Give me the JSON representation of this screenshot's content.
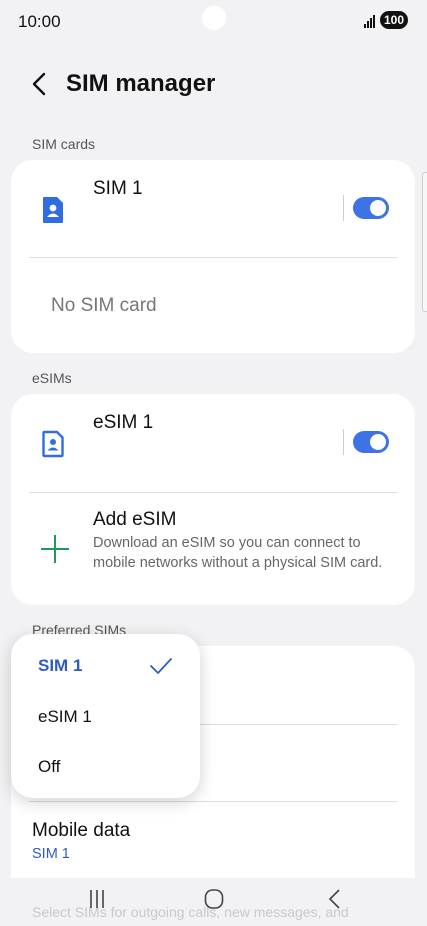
{
  "status_bar": {
    "time": "10:00",
    "battery": "100"
  },
  "header": {
    "title": "SIM manager"
  },
  "sim_cards": {
    "section_label": "SIM cards",
    "sim1": {
      "name": "SIM 1",
      "enabled": true
    },
    "empty_slot": "No SIM card"
  },
  "esims": {
    "section_label": "eSIMs",
    "esim1": {
      "name": "eSIM 1",
      "enabled": true
    },
    "add": {
      "title": "Add eSIM",
      "description": "Download an eSIM so you can connect to mobile networks without a physical SIM card."
    }
  },
  "preferred_sims": {
    "section_label": "Preferred SIMs",
    "mobile_data": {
      "title": "Mobile data",
      "value": "SIM 1"
    }
  },
  "popup": {
    "options": [
      "SIM 1",
      "eSIM 1",
      "Off"
    ],
    "selected": "SIM 1"
  },
  "footer_text": "Select SIMs for outgoing calls, new messages, and",
  "colors": {
    "accent": "#3e73e8",
    "icon_blue": "#2f6de0",
    "add_green": "#1a9b5a"
  },
  "icons": [
    "back-arrow-icon",
    "sim-card-icon",
    "esim-icon",
    "plus-icon",
    "checkmark-icon",
    "recents-icon",
    "home-icon",
    "back-icon"
  ]
}
